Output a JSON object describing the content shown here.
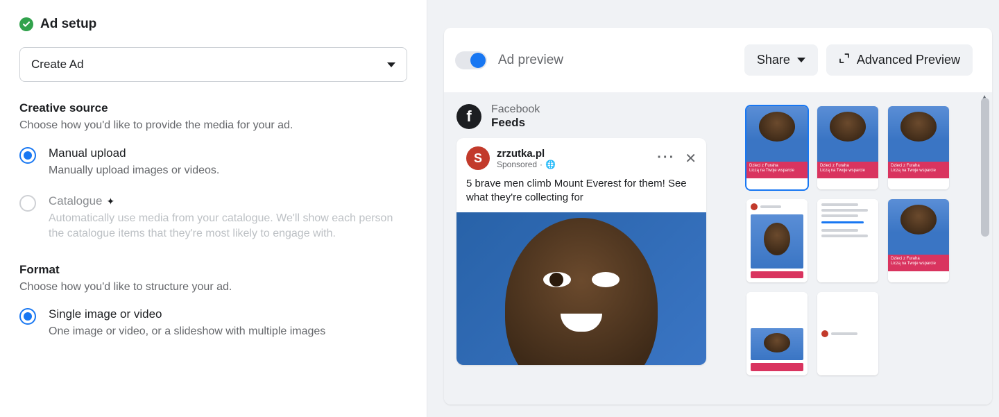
{
  "left": {
    "title": "Ad setup",
    "select_value": "Create Ad",
    "creative": {
      "title": "Creative source",
      "desc": "Choose how you'd like to provide the media for your ad.",
      "manual": {
        "label": "Manual upload",
        "hint": "Manually upload images or videos."
      },
      "catalogue": {
        "label": "Catalogue",
        "hint": "Automatically use media from your catalogue. We'll show each person the catalogue items that they're most likely to engage with."
      }
    },
    "format": {
      "title": "Format",
      "desc": "Choose how you'd like to structure your ad.",
      "single": {
        "label": "Single image or video",
        "hint": "One image or video, or a slideshow with multiple images"
      }
    }
  },
  "preview": {
    "title": "Ad preview",
    "share": "Share",
    "advanced": "Advanced Preview",
    "platform": "Facebook",
    "placement": "Feeds",
    "post": {
      "name": "zrzutka.pl",
      "sponsored": "Sponsored",
      "text": "5 brave men climb Mount Everest for them! See what they're collecting for"
    },
    "thumb_label_1": "Dzieci z Furaha",
    "thumb_label_2": "Liczą na Twoje wsparcie"
  }
}
